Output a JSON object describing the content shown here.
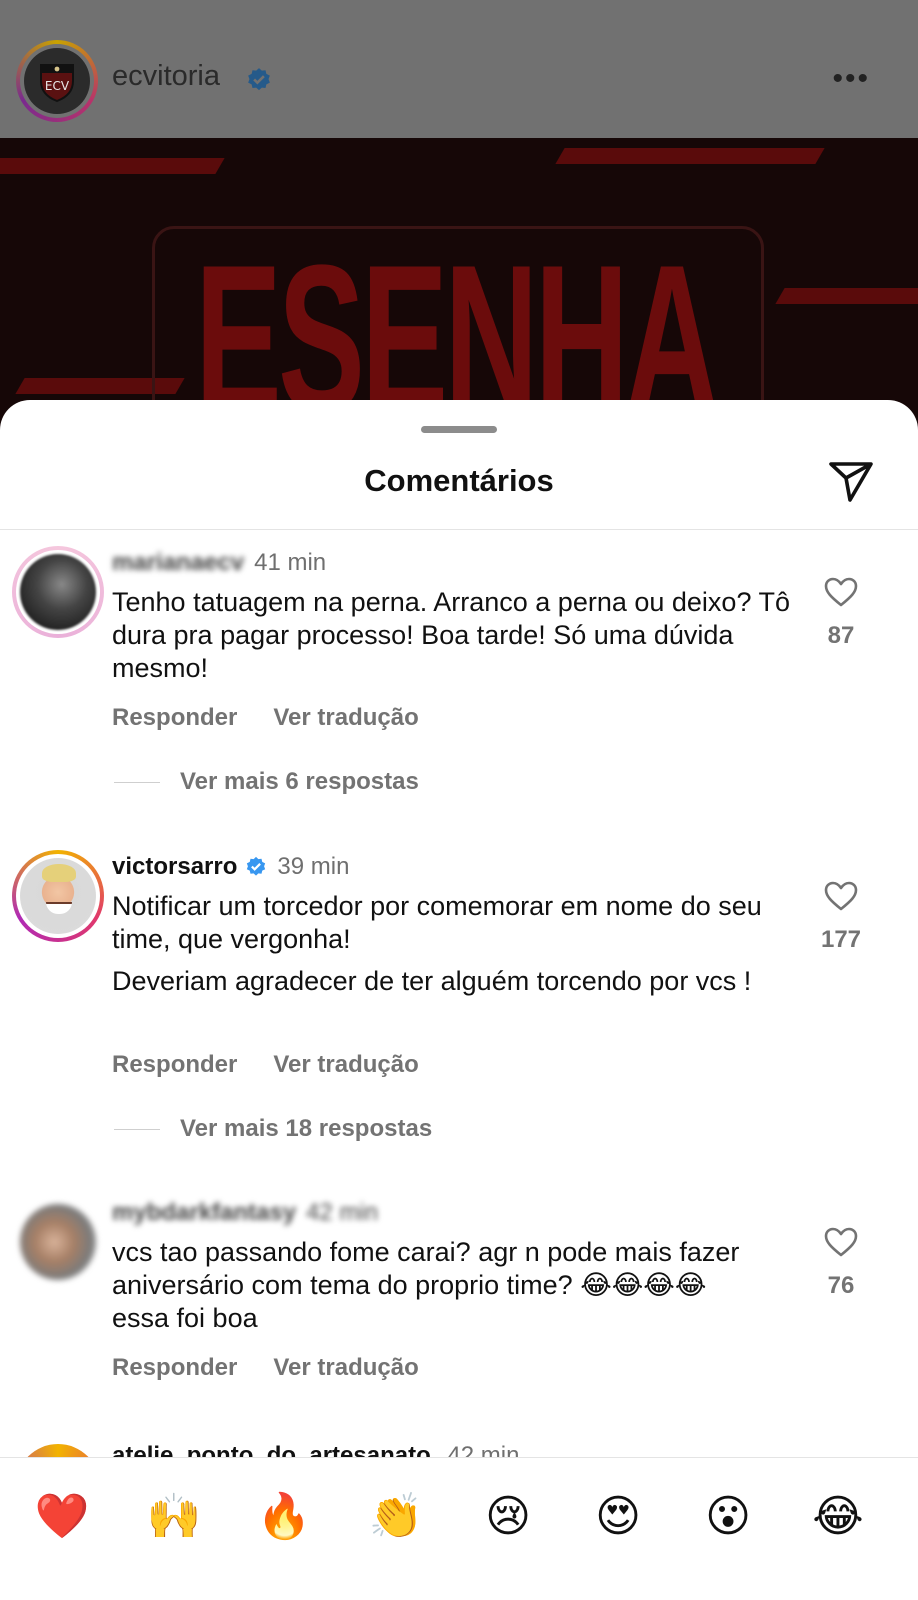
{
  "post": {
    "username": "ecvitoria",
    "image_text": "ESENHA"
  },
  "sheet": {
    "title": "Comentários"
  },
  "comments": [
    {
      "username": "marianaecv",
      "time": "41 min",
      "text": [
        "Tenho tatuagem na perna. Arranco a perna ou deixo? Tô dura pra pagar processo! Boa tarde! Só uma dúvida mesmo!"
      ],
      "likes": "87",
      "reply_label": "Responder",
      "translate_label": "Ver tradução",
      "more_replies": "Ver mais 6 respostas"
    },
    {
      "username": "victorsarro",
      "time": "39 min",
      "verified": true,
      "text": [
        "Notificar um torcedor por comemorar em nome do seu time, que vergonha!",
        "Deveriam agradecer de ter alguém torcendo por vcs !"
      ],
      "likes": "177",
      "reply_label": "Responder",
      "translate_label": "Ver tradução",
      "more_replies": "Ver mais 18 respostas"
    },
    {
      "username": "mybdarkfantasy",
      "time": "42 min",
      "text": [
        "vcs tao passando fome carai? agr n pode mais fazer aniversário com tema do proprio time? 😂😂😂😂 essa foi boa"
      ],
      "likes": "76",
      "reply_label": "Responder",
      "translate_label": "Ver tradução"
    },
    {
      "username": "atelie_ponto_do_artesanato",
      "time": "42 min"
    }
  ],
  "reactions": [
    {
      "icon": "red-heart",
      "glyph": "❤️"
    },
    {
      "icon": "raising-hands",
      "glyph": "🙌"
    },
    {
      "icon": "fire",
      "glyph": "🔥"
    },
    {
      "icon": "clapping-hands",
      "glyph": "👏"
    },
    {
      "icon": "crying-face",
      "glyph": "😢"
    },
    {
      "icon": "heart-eyes-face",
      "glyph": "😍"
    },
    {
      "icon": "astonished-face",
      "glyph": "😮"
    },
    {
      "icon": "tears-of-joy-face",
      "glyph": "😂"
    }
  ],
  "colors": {
    "verified": "#3897f0",
    "secondary_text": "#737373",
    "ring_start": "#f2b300",
    "ring_end": "#b02ab5"
  }
}
